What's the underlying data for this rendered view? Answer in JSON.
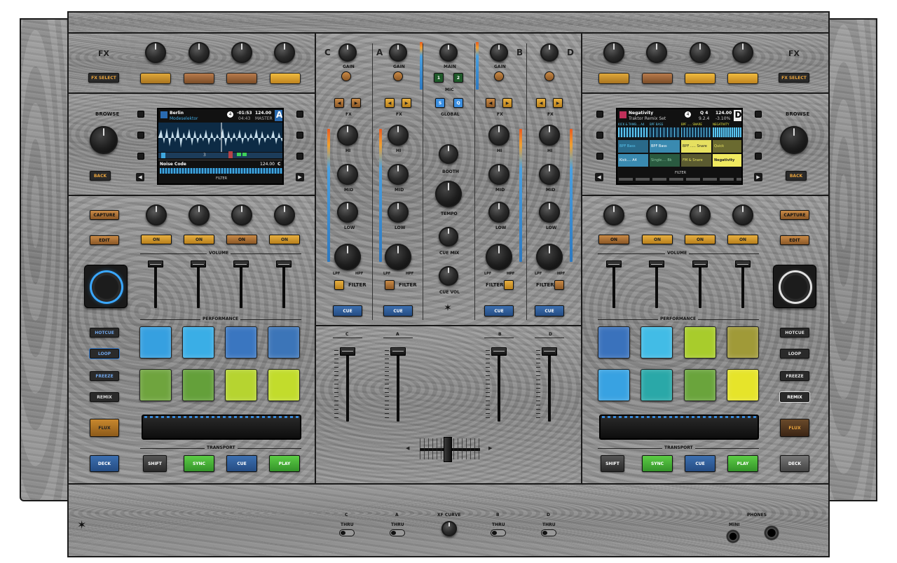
{
  "colors": {
    "amber_button": "#e8b040",
    "blue_button": "#3c6fb0",
    "green_button": "#5ccd45",
    "wood_grey": "#8e8e8e",
    "jog_ring_left": "#3aa7ff",
    "jog_ring_right": "#e0e0e0"
  },
  "left_deck": {
    "fx": {
      "title": "FX",
      "select_label": "FX SELECT"
    },
    "browse_label": "BROWSE",
    "back_label": "BACK",
    "screen": {
      "track_title": "Berlin",
      "artist": "Modeselektor",
      "deck_letter": "A",
      "time_remaining": "-01:53",
      "time_elapsed": "04:43",
      "bpm": "124.00",
      "sync_mode": "MASTER",
      "loop_size": "4",
      "marker_number": "3",
      "bottom_track": "Noise Code",
      "bottom_bpm": "124.00",
      "bottom_deck": "C",
      "filter_label": "FILTER"
    },
    "capture_label": "CAPTURE",
    "edit_label": "EDIT",
    "on_labels": [
      "ON",
      "ON",
      "ON",
      "ON"
    ],
    "volume_label": "VOLUME",
    "performance_label": "PERFORMANCE",
    "mode_buttons": [
      "HOTCUE",
      "LOOP",
      "FREEZE",
      "REMIX"
    ],
    "flux_label": "FLUX",
    "transport_label": "TRANSPORT",
    "deck_label": "DECK",
    "transport_buttons": [
      "SHIFT",
      "SYNC",
      "CUE",
      "PLAY"
    ]
  },
  "right_deck": {
    "fx": {
      "title": "FX",
      "select_label": "FX SELECT"
    },
    "browse_label": "BROWSE",
    "back_label": "BACK",
    "screen": {
      "track_title": "Negativity",
      "set_name": "Traktor Remix Set",
      "deck_letter": "D",
      "quantize": "Q 4",
      "position": "9.2.4",
      "bpm": "124.00",
      "tempo_offset": "-3.10%",
      "loop_size": "4",
      "slot_headers": [
        "KICK & TAMB.... A4",
        "BPF BASS",
        "BPF ..... SNARE",
        "NEGATIVITY"
      ],
      "cells": [
        "BPF Bass",
        "BPF Bass",
        "BPF ..... Snare",
        "Quick",
        "Kick.... A4",
        "Single.... Bk",
        "FM & Snare",
        "Negativity"
      ],
      "filter_label": "FILTER"
    },
    "capture_label": "CAPTURE",
    "edit_label": "EDIT",
    "on_labels": [
      "ON",
      "ON",
      "ON",
      "ON"
    ],
    "volume_label": "VOLUME",
    "performance_label": "PERFORMANCE",
    "mode_buttons": [
      "HOTCUE",
      "LOOP",
      "FREEZE",
      "REMIX"
    ],
    "flux_label": "FLUX",
    "transport_label": "TRANSPORT",
    "deck_label": "DECK",
    "transport_buttons": [
      "SHIFT",
      "SYNC",
      "CUE",
      "PLAY"
    ]
  },
  "mixer": {
    "channel_letters": [
      "C",
      "A",
      "B",
      "D"
    ],
    "gain_label": "GAIN",
    "main_label": "MAIN",
    "mic_label": "MIC",
    "mic_buttons": [
      "1",
      "2"
    ],
    "global_label": "GLOBAL",
    "global_buttons": [
      "S",
      "Q"
    ],
    "fx_label": "FX",
    "eq_labels": [
      "HI",
      "MID",
      "LOW"
    ],
    "filter_label": "FILTER",
    "lpf_label": "LPF",
    "hpf_label": "HPF",
    "cue_label": "CUE",
    "booth_label": "BOOTH",
    "tempo_label": "TEMPO",
    "cue_mix_label": "CUE MIX",
    "cue_vol_label": "CUE VOL",
    "fader_letters": [
      "C",
      "A",
      "B",
      "D"
    ]
  },
  "front_panel": {
    "thru_groups": [
      {
        "letter": "C",
        "label": "THRU"
      },
      {
        "letter": "A",
        "label": "THRU"
      },
      {
        "letter": "B",
        "label": "THRU"
      },
      {
        "letter": "D",
        "label": "THRU"
      }
    ],
    "xf_curve_label": "XF CURVE",
    "phones_label": "PHONES",
    "mini_label": "MINI"
  }
}
